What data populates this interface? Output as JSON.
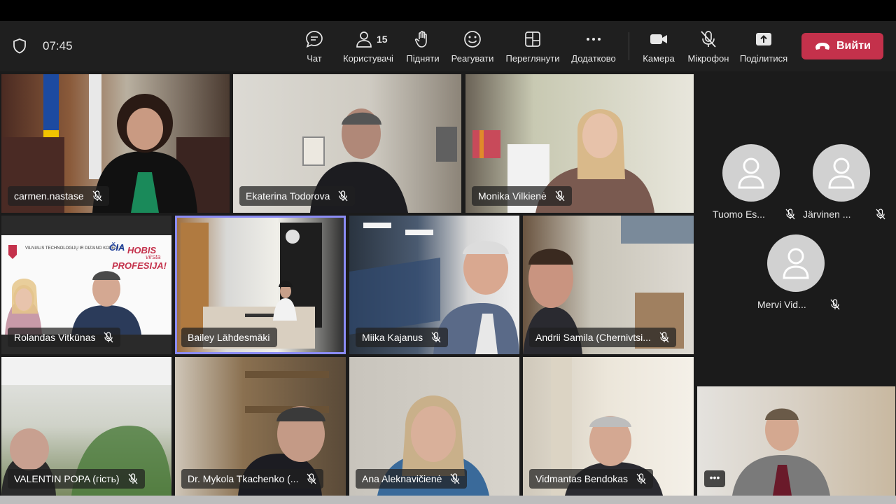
{
  "meeting": {
    "time": "07:45",
    "shield_icon": "shield-icon"
  },
  "toolbar": {
    "chat": {
      "label": "Чат",
      "icon": "chat-icon"
    },
    "people": {
      "label": "Користувачі",
      "count": "15",
      "icon": "people-icon"
    },
    "raise": {
      "label": "Підняти",
      "icon": "raise-hand-icon"
    },
    "react": {
      "label": "Реагувати",
      "icon": "smile-icon"
    },
    "view": {
      "label": "Переглянути",
      "icon": "layout-icon"
    },
    "more": {
      "label": "Додатково",
      "icon": "more-icon"
    },
    "camera": {
      "label": "Камера",
      "icon": "camera-icon"
    },
    "mic": {
      "label": "Мікрофон",
      "icon": "mic-off-icon"
    },
    "share": {
      "label": "Поділитися",
      "icon": "share-icon"
    },
    "leave": {
      "label": "Вийти",
      "icon": "phone-hangup-icon",
      "color": "#c4314b"
    }
  },
  "participants": [
    {
      "name": "carmen.nastase"
    },
    {
      "name": "Ekaterina Todorova"
    },
    {
      "name": "Monika Vilkienė"
    },
    {
      "name": "Rolandas Vitkūnas"
    },
    {
      "name": "Bailey Lähdesmäki",
      "active": true
    },
    {
      "name": "Miika Kajanus"
    },
    {
      "name": "Andrii Samila (Chernivtsi..."
    },
    {
      "name": "VALENTIN POPA (гість)"
    },
    {
      "name": "Dr. Mykola Tkachenko (..."
    },
    {
      "name": "Ana Aleknavičienė"
    },
    {
      "name": "Vidmantas Bendokas"
    }
  ],
  "audio_only": [
    {
      "name": "Tuomo Es..."
    },
    {
      "name": "Järvinen ..."
    },
    {
      "name": "Mervi Vid..."
    }
  ],
  "self_view": {
    "more_label": "•••"
  },
  "banner": {
    "school": "VILNIAUS TECHNOLOGIJŲ IR DIZAINO KOLEGIJA",
    "slogan_1": "ČIA",
    "slogan_2": "HOBIS",
    "slogan_3": "virsta",
    "slogan_4": "PROFESIJA!"
  },
  "colors": {
    "accent": "#8b8cf5",
    "leave": "#c4314b",
    "toolbar": "#1f1f1f",
    "stage": "#1b1b1b"
  }
}
